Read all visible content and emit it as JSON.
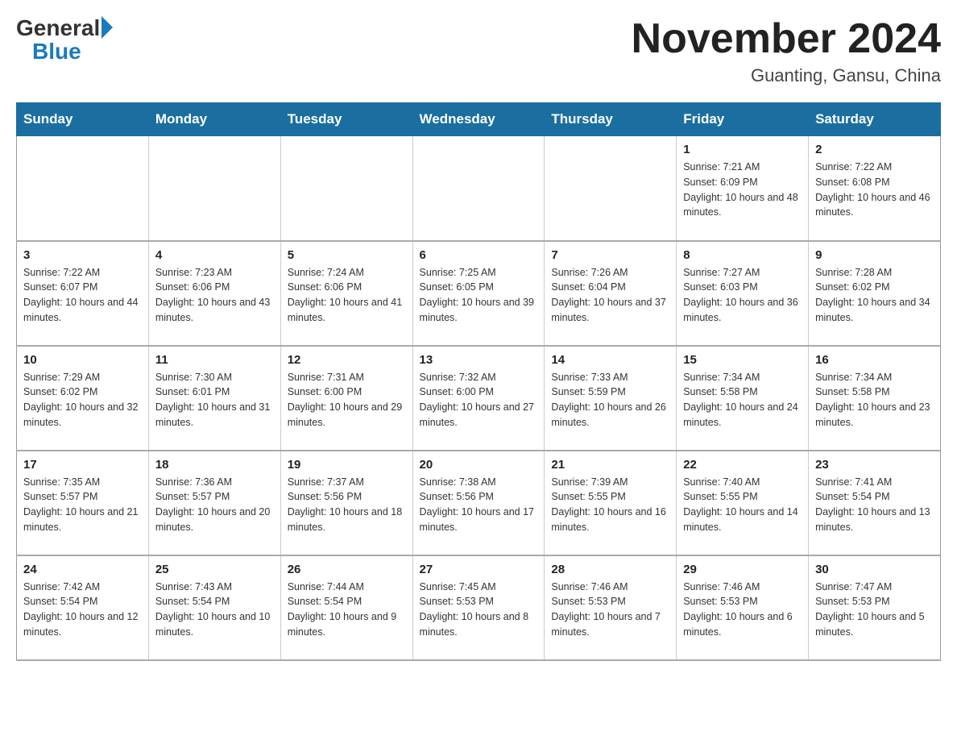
{
  "logo": {
    "general": "General",
    "blue": "Blue",
    "triangle": "▶"
  },
  "title": "November 2024",
  "subtitle": "Guanting, Gansu, China",
  "days_header": [
    "Sunday",
    "Monday",
    "Tuesday",
    "Wednesday",
    "Thursday",
    "Friday",
    "Saturday"
  ],
  "weeks": [
    [
      {
        "day": "",
        "info": ""
      },
      {
        "day": "",
        "info": ""
      },
      {
        "day": "",
        "info": ""
      },
      {
        "day": "",
        "info": ""
      },
      {
        "day": "",
        "info": ""
      },
      {
        "day": "1",
        "info": "Sunrise: 7:21 AM\nSunset: 6:09 PM\nDaylight: 10 hours and 48 minutes."
      },
      {
        "day": "2",
        "info": "Sunrise: 7:22 AM\nSunset: 6:08 PM\nDaylight: 10 hours and 46 minutes."
      }
    ],
    [
      {
        "day": "3",
        "info": "Sunrise: 7:22 AM\nSunset: 6:07 PM\nDaylight: 10 hours and 44 minutes."
      },
      {
        "day": "4",
        "info": "Sunrise: 7:23 AM\nSunset: 6:06 PM\nDaylight: 10 hours and 43 minutes."
      },
      {
        "day": "5",
        "info": "Sunrise: 7:24 AM\nSunset: 6:06 PM\nDaylight: 10 hours and 41 minutes."
      },
      {
        "day": "6",
        "info": "Sunrise: 7:25 AM\nSunset: 6:05 PM\nDaylight: 10 hours and 39 minutes."
      },
      {
        "day": "7",
        "info": "Sunrise: 7:26 AM\nSunset: 6:04 PM\nDaylight: 10 hours and 37 minutes."
      },
      {
        "day": "8",
        "info": "Sunrise: 7:27 AM\nSunset: 6:03 PM\nDaylight: 10 hours and 36 minutes."
      },
      {
        "day": "9",
        "info": "Sunrise: 7:28 AM\nSunset: 6:02 PM\nDaylight: 10 hours and 34 minutes."
      }
    ],
    [
      {
        "day": "10",
        "info": "Sunrise: 7:29 AM\nSunset: 6:02 PM\nDaylight: 10 hours and 32 minutes."
      },
      {
        "day": "11",
        "info": "Sunrise: 7:30 AM\nSunset: 6:01 PM\nDaylight: 10 hours and 31 minutes."
      },
      {
        "day": "12",
        "info": "Sunrise: 7:31 AM\nSunset: 6:00 PM\nDaylight: 10 hours and 29 minutes."
      },
      {
        "day": "13",
        "info": "Sunrise: 7:32 AM\nSunset: 6:00 PM\nDaylight: 10 hours and 27 minutes."
      },
      {
        "day": "14",
        "info": "Sunrise: 7:33 AM\nSunset: 5:59 PM\nDaylight: 10 hours and 26 minutes."
      },
      {
        "day": "15",
        "info": "Sunrise: 7:34 AM\nSunset: 5:58 PM\nDaylight: 10 hours and 24 minutes."
      },
      {
        "day": "16",
        "info": "Sunrise: 7:34 AM\nSunset: 5:58 PM\nDaylight: 10 hours and 23 minutes."
      }
    ],
    [
      {
        "day": "17",
        "info": "Sunrise: 7:35 AM\nSunset: 5:57 PM\nDaylight: 10 hours and 21 minutes."
      },
      {
        "day": "18",
        "info": "Sunrise: 7:36 AM\nSunset: 5:57 PM\nDaylight: 10 hours and 20 minutes."
      },
      {
        "day": "19",
        "info": "Sunrise: 7:37 AM\nSunset: 5:56 PM\nDaylight: 10 hours and 18 minutes."
      },
      {
        "day": "20",
        "info": "Sunrise: 7:38 AM\nSunset: 5:56 PM\nDaylight: 10 hours and 17 minutes."
      },
      {
        "day": "21",
        "info": "Sunrise: 7:39 AM\nSunset: 5:55 PM\nDaylight: 10 hours and 16 minutes."
      },
      {
        "day": "22",
        "info": "Sunrise: 7:40 AM\nSunset: 5:55 PM\nDaylight: 10 hours and 14 minutes."
      },
      {
        "day": "23",
        "info": "Sunrise: 7:41 AM\nSunset: 5:54 PM\nDaylight: 10 hours and 13 minutes."
      }
    ],
    [
      {
        "day": "24",
        "info": "Sunrise: 7:42 AM\nSunset: 5:54 PM\nDaylight: 10 hours and 12 minutes."
      },
      {
        "day": "25",
        "info": "Sunrise: 7:43 AM\nSunset: 5:54 PM\nDaylight: 10 hours and 10 minutes."
      },
      {
        "day": "26",
        "info": "Sunrise: 7:44 AM\nSunset: 5:54 PM\nDaylight: 10 hours and 9 minutes."
      },
      {
        "day": "27",
        "info": "Sunrise: 7:45 AM\nSunset: 5:53 PM\nDaylight: 10 hours and 8 minutes."
      },
      {
        "day": "28",
        "info": "Sunrise: 7:46 AM\nSunset: 5:53 PM\nDaylight: 10 hours and 7 minutes."
      },
      {
        "day": "29",
        "info": "Sunrise: 7:46 AM\nSunset: 5:53 PM\nDaylight: 10 hours and 6 minutes."
      },
      {
        "day": "30",
        "info": "Sunrise: 7:47 AM\nSunset: 5:53 PM\nDaylight: 10 hours and 5 minutes."
      }
    ]
  ]
}
